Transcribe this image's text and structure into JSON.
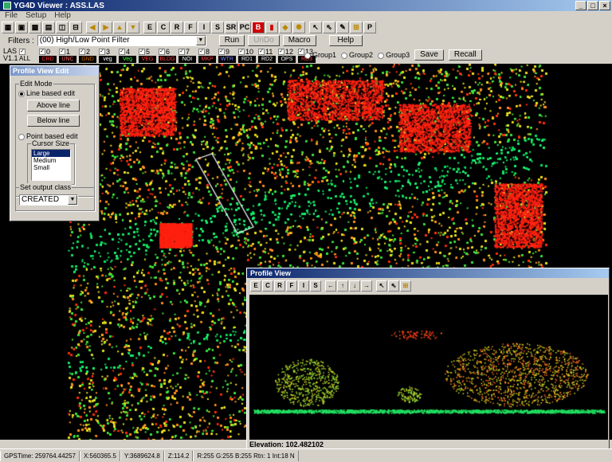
{
  "window": {
    "title": "YG4D Viewer : ASS.LAS",
    "minimize": "_",
    "maximize": "□",
    "close": "×"
  },
  "menu": [
    "File",
    "Setup",
    "Help"
  ],
  "toolbar": {
    "icons": [
      "open-icon",
      "save-icon",
      "grid-icon",
      "layers-icon",
      "zoom-icon",
      "measure-icon",
      "left-arrow-icon",
      "right-arrow-icon",
      "up-arrow-icon",
      "down-arrow-icon"
    ],
    "letters": [
      "E",
      "C",
      "R",
      "F",
      "I",
      "S",
      "SR",
      "PC",
      "B"
    ],
    "tools": [
      "pointer-icon",
      "select-icon",
      "draw-icon",
      "profile-icon"
    ],
    "p_label": "P"
  },
  "filters": {
    "label": "Filters :",
    "value": "(00) High/Low Point Filter",
    "run": "Run",
    "undo": "UnDo",
    "macro": "Macro",
    "help": "Help"
  },
  "las": {
    "line1": "LAS",
    "line2": "V1.1",
    "all": "ALL",
    "classes": [
      {
        "n": "0",
        "tag": "CRD",
        "color": "#ff3030"
      },
      {
        "n": "1",
        "tag": "UNC",
        "color": "#ff6060"
      },
      {
        "n": "2",
        "tag": "GND",
        "color": "#cc6600"
      },
      {
        "n": "3",
        "tag": "veg",
        "color": "#ffffff"
      },
      {
        "n": "4",
        "tag": "Veg",
        "color": "#40ff40"
      },
      {
        "n": "5",
        "tag": "VEG",
        "color": "#ff4040"
      },
      {
        "n": "6",
        "tag": "BLDG",
        "color": "#ff4040"
      },
      {
        "n": "7",
        "tag": "NOI",
        "color": "#ffffff"
      },
      {
        "n": "8",
        "tag": "MKP",
        "color": "#ff4040"
      },
      {
        "n": "9",
        "tag": "WTR",
        "color": "#8080ff"
      },
      {
        "n": "10",
        "tag": "RD1",
        "color": "#ffffff"
      },
      {
        "n": "11",
        "tag": "RD2",
        "color": "#ffffff"
      },
      {
        "n": "12",
        "tag": "OPS",
        "color": "#ffffff"
      },
      {
        "n": "13",
        "tag": "RD3",
        "color": "#ff4040"
      }
    ],
    "groups": [
      "Group1",
      "Group2",
      "Group3"
    ],
    "save": "Save",
    "recall": "Recall"
  },
  "profile_edit": {
    "title": "Profile View Edit",
    "edit_mode": "Edit Mode",
    "line_based": "Line based edit",
    "above_line": "Above line",
    "below_line": "Below line",
    "point_based": "Point based edit",
    "cursor_size": "Cursor Size",
    "sizes": [
      "Large",
      "Medium",
      "Small"
    ],
    "output_class_label": "Set output class",
    "output_class": "CREATED"
  },
  "profile_view": {
    "title": "Profile View",
    "letters": [
      "E",
      "C",
      "R",
      "F",
      "I",
      "S"
    ],
    "elevation": "Elevation: 102.482102"
  },
  "status": [
    "GPSTime: 259764.44257",
    "X:560365.5",
    "Y:3689624.8",
    "Z:114.2",
    "R:255 G:255 B:255 Rtn: 1 Int:18 N"
  ]
}
